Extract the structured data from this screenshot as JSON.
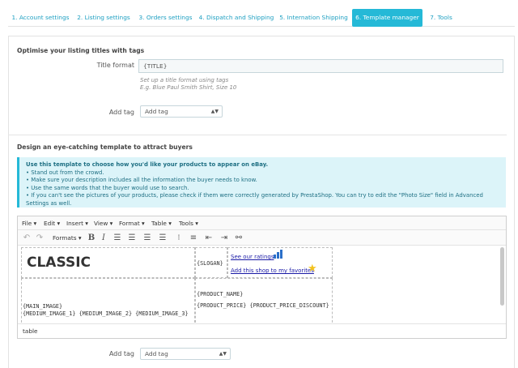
{
  "tabs": [
    {
      "label": "1. Account settings",
      "active": false
    },
    {
      "label": "2. Listing settings",
      "active": false
    },
    {
      "label": "3. Orders settings",
      "active": false
    },
    {
      "label": "4. Dispatch and Shipping",
      "active": false
    },
    {
      "label": "5. Internation Shipping",
      "active": false
    },
    {
      "label": "6. Template manager",
      "active": true
    },
    {
      "label": "7. Tools",
      "active": false
    }
  ],
  "colors": {
    "accent": "#25b9d7",
    "link": "#1fa0c2",
    "alert_bg": "#dcf4f9"
  },
  "titles": {
    "section_title": "Optimise your listing titles with tags",
    "label": "Title format",
    "value": "{TITLE}",
    "help_1": "Set up a title format using tags",
    "help_2": "E.g. Blue Paul Smith Shirt, Size 10",
    "add_tag_label": "Add tag",
    "add_tag_value": "Add tag"
  },
  "template": {
    "section_title": "Design an eye-catching template to attract buyers",
    "alert_title": "Use this template to choose how you'd like your products to appear on eBay.",
    "alert_items": [
      "Stand out from the crowd.",
      "Make sure your description includes all the information the buyer needs to know.",
      "Use the same words that the buyer would use to search.",
      "If you can't see the pictures of your products, please check if them were correctly generated by PrestaShop. You can try to edit the \"Photo Size\" field in Advanced Settings as well."
    ],
    "add_tag_label": "Add tag",
    "add_tag_value": "Add tag"
  },
  "editor": {
    "menus": [
      "File",
      "Edit",
      "Insert",
      "View",
      "Format",
      "Table",
      "Tools"
    ],
    "formats_label": "Formats",
    "toolbar_icons": [
      "undo-icon",
      "redo-icon",
      "bold-icon",
      "italic-icon",
      "align-left-icon",
      "align-center-icon",
      "align-right-icon",
      "align-justify-icon",
      "bullet-list-icon",
      "numbered-list-icon",
      "outdent-icon",
      "indent-icon",
      "link-icon"
    ],
    "content": {
      "heading": "CLASSIC",
      "slogan": "{SLOGAN}",
      "see_ratings": "See our ratings",
      "add_favorites": "Add this shop to my favorites",
      "main_image": "{MAIN_IMAGE}",
      "medium_images": "{MEDIUM_IMAGE_1} {MEDIUM_IMAGE_2} {MEDIUM_IMAGE_3}",
      "product_name": "{PRODUCT_NAME}",
      "product_price": "{PRODUCT_PRICE} {PRODUCT_PRICE_DISCOUNT}"
    },
    "status_path": "table"
  }
}
